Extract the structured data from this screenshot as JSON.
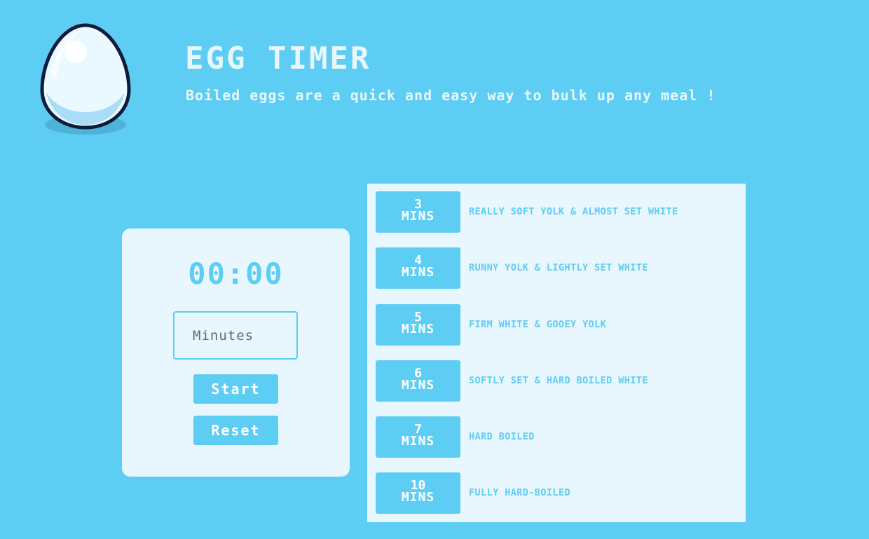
{
  "header": {
    "title": "EGG TIMER",
    "subtitle": "Boiled eggs are a quick and easy way to bulk up any meal !",
    "logo_icon": "pixel-egg-icon"
  },
  "timer": {
    "display": "00:00",
    "input_placeholder": "Minutes",
    "input_value": "",
    "start_label": "Start",
    "reset_label": "Reset"
  },
  "presets": [
    {
      "num": "3",
      "unit": "MINS",
      "desc": "REALLY SOFT YOLK & ALMOST SET WHITE"
    },
    {
      "num": "4",
      "unit": "MINS",
      "desc": "RUNNY YOLK & LIGHTLY SET WHITE"
    },
    {
      "num": "5",
      "unit": "MINS",
      "desc": "FIRM WHITE & GOOEY YOLK"
    },
    {
      "num": "6",
      "unit": "MINS",
      "desc": "SOFTLY SET & HARD BOILED WHITE"
    },
    {
      "num": "7",
      "unit": "MINS",
      "desc": "HARD BOILED"
    },
    {
      "num": "10",
      "unit": "MINS",
      "desc": "FULLY HARD-BOILED"
    }
  ],
  "colors": {
    "background": "#5ecdf3",
    "panel": "#e8f7fd",
    "accent": "#5ecdf3",
    "egg_outline": "#0d1b3d"
  }
}
